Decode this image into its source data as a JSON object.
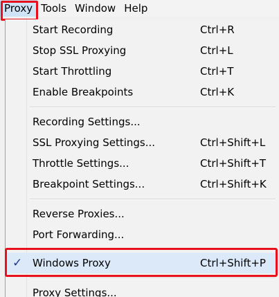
{
  "menubar": {
    "items": [
      {
        "label": "Proxy"
      },
      {
        "label": "Tools"
      },
      {
        "label": "Window"
      },
      {
        "label": "Help"
      }
    ]
  },
  "proxy_menu": {
    "items": [
      {
        "label": "Start Recording",
        "shortcut": "Ctrl+R"
      },
      {
        "label": "Stop SSL Proxying",
        "shortcut": "Ctrl+L"
      },
      {
        "label": "Start Throttling",
        "shortcut": "Ctrl+T"
      },
      {
        "label": "Enable Breakpoints",
        "shortcut": "Ctrl+K"
      },
      {
        "label": "Recording Settings..."
      },
      {
        "label": "SSL Proxying Settings...",
        "shortcut": "Ctrl+Shift+L"
      },
      {
        "label": "Throttle Settings...",
        "shortcut": "Ctrl+Shift+T"
      },
      {
        "label": "Breakpoint Settings...",
        "shortcut": "Ctrl+Shift+K"
      },
      {
        "label": "Reverse Proxies..."
      },
      {
        "label": "Port Forwarding..."
      },
      {
        "label": "Windows Proxy",
        "shortcut": "Ctrl+Shift+P",
        "checked": true,
        "check_glyph": "✓"
      },
      {
        "label": "Proxy Settings..."
      }
    ]
  },
  "colors": {
    "highlight_border": "#e8101c",
    "checkmark": "#1a3a8f",
    "menu_background": "#f2f2f2"
  }
}
